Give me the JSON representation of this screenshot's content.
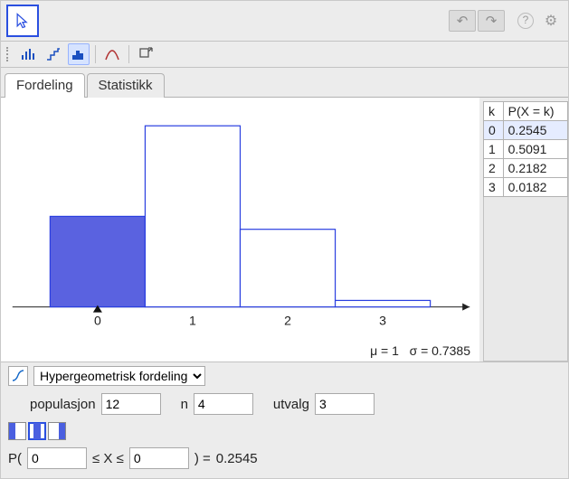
{
  "titlebar": {
    "undo_icon": "↶",
    "redo_icon": "↷",
    "help_icon": "?",
    "gear_icon": "⚙"
  },
  "tabs": [
    {
      "label": "Fordeling",
      "active": true
    },
    {
      "label": "Statistikk",
      "active": false
    }
  ],
  "chart_data": {
    "type": "bar",
    "categories": [
      0,
      1,
      2,
      3
    ],
    "values": [
      0.2545,
      0.5091,
      0.2182,
      0.0182
    ],
    "highlight_up_to": 0,
    "title": "",
    "xlabel": "",
    "ylabel": "",
    "ylim": [
      0,
      0.55
    ],
    "xlim": [
      -0.8,
      3.8
    ],
    "mu": 1,
    "sigma": 0.7385,
    "mu_label": "μ = 1",
    "sigma_label": "σ = 0.7385"
  },
  "table": {
    "headers": [
      "k",
      "P(X = k)"
    ],
    "rows": [
      {
        "k": 0,
        "p": "0.2545",
        "highlight": true
      },
      {
        "k": 1,
        "p": "0.5091",
        "highlight": false
      },
      {
        "k": 2,
        "p": "0.2182",
        "highlight": false
      },
      {
        "k": 3,
        "p": "0.0182",
        "highlight": false
      }
    ]
  },
  "distribution": {
    "selected_label": "Hypergeometrisk fordeling",
    "params": [
      {
        "label": "populasjon",
        "value": "12"
      },
      {
        "label": "n",
        "value": "4"
      },
      {
        "label": "utvalg",
        "value": "3"
      }
    ]
  },
  "probability": {
    "prefix": "P(",
    "lower": "0",
    "mid": " ≤ X ≤ ",
    "upper": "0",
    "suffix": " )  =  ",
    "result": "0.2545"
  }
}
